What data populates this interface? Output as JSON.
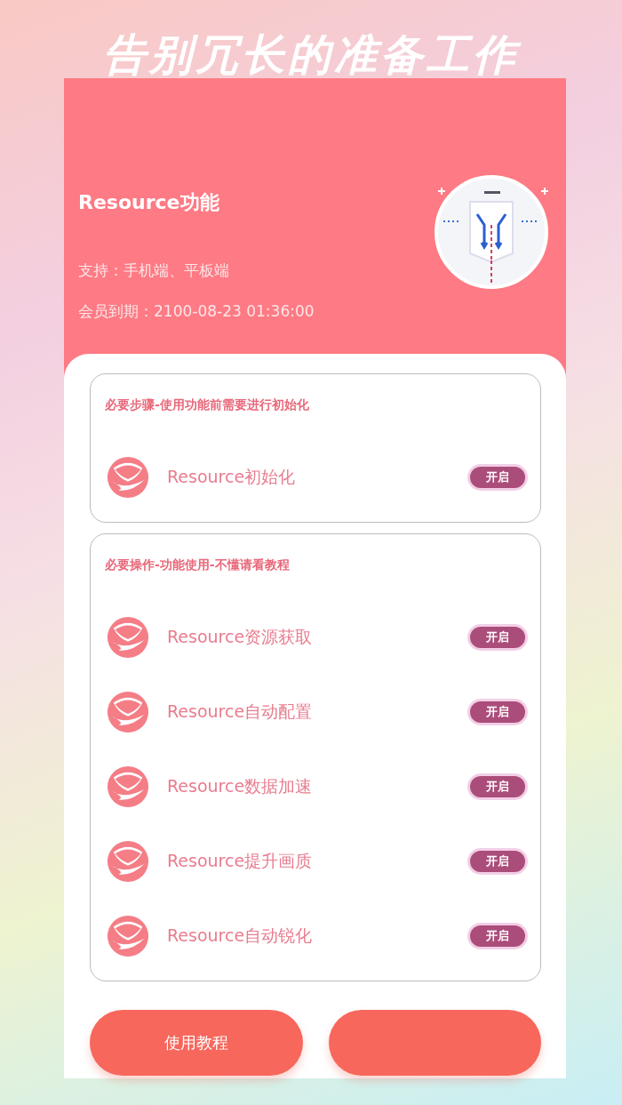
{
  "headline": "告别冗长的准备工作",
  "header": {
    "title": "Resource功能",
    "support": "支持：手机端、平板端",
    "expiry": "会员到期：2100-08-23 01:36:00"
  },
  "sections": [
    {
      "title": "必要步骤-使用功能前需要进行初始化",
      "items": [
        {
          "label": "Resource初始化",
          "button": "开启"
        }
      ]
    },
    {
      "title": "必要操作-功能使用-不懂请看教程",
      "items": [
        {
          "label": "Resource资源获取",
          "button": "开启"
        },
        {
          "label": "Resource自动配置",
          "button": "开启"
        },
        {
          "label": "Resource数据加速",
          "button": "开启"
        },
        {
          "label": "Resource提升画质",
          "button": "开启"
        },
        {
          "label": "Resource自动锐化",
          "button": "开启"
        }
      ]
    }
  ],
  "buttons": [
    {
      "kind": "labeled",
      "label": "使用教程"
    },
    {
      "kind": "covered"
    }
  ]
}
